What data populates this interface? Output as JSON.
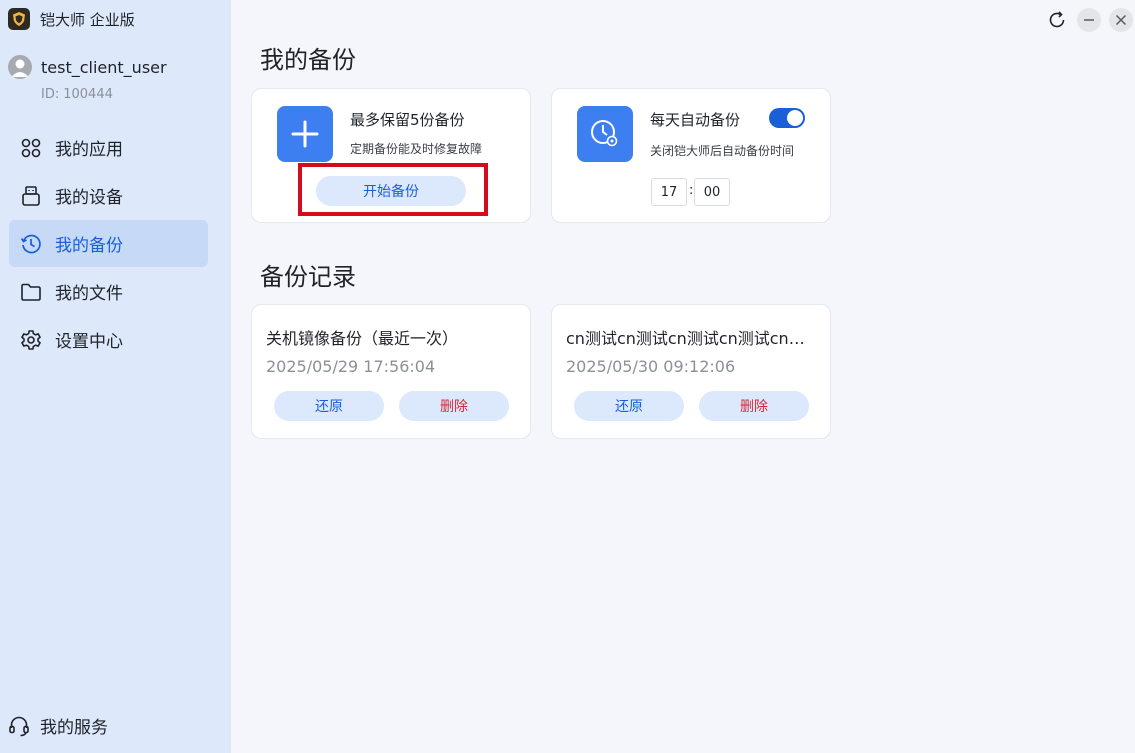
{
  "app": {
    "title": "铠大师 企业版"
  },
  "user": {
    "name": "test_client_user",
    "id_label": "ID:",
    "id_value": "100444"
  },
  "nav": {
    "items": [
      {
        "label": "我的应用",
        "icon": "apps-icon"
      },
      {
        "label": "我的设备",
        "icon": "device-icon"
      },
      {
        "label": "我的备份",
        "icon": "backup-history-icon",
        "active": true
      },
      {
        "label": "我的文件",
        "icon": "folder-icon"
      },
      {
        "label": "设置中心",
        "icon": "settings-icon"
      }
    ],
    "service_label": "我的服务"
  },
  "main": {
    "backup_section_title": "我的备份",
    "new_backup": {
      "title": "最多保留5份备份",
      "subtitle": "定期备份能及时修复故障",
      "button": "开始备份"
    },
    "auto_backup": {
      "title": "每天自动备份",
      "subtitle": "关闭铠大师后自动备份时间",
      "enabled": true,
      "hour": "17",
      "minute": "00",
      "separator": ":"
    },
    "records_section_title": "备份记录",
    "records": [
      {
        "title": "关机镜像备份（最近一次）",
        "time": "2025/05/29 17:56:04",
        "restore": "还原",
        "delete": "删除"
      },
      {
        "title": "cn测试cn测试cn测试cn测试cn…",
        "time": "2025/05/30 09:12:06",
        "restore": "还原",
        "delete": "删除"
      }
    ]
  },
  "colors": {
    "accent": "#1a5fd8",
    "danger": "#d6293a",
    "highlight": "#d40b1c",
    "sidebar": "#dde8fa"
  }
}
